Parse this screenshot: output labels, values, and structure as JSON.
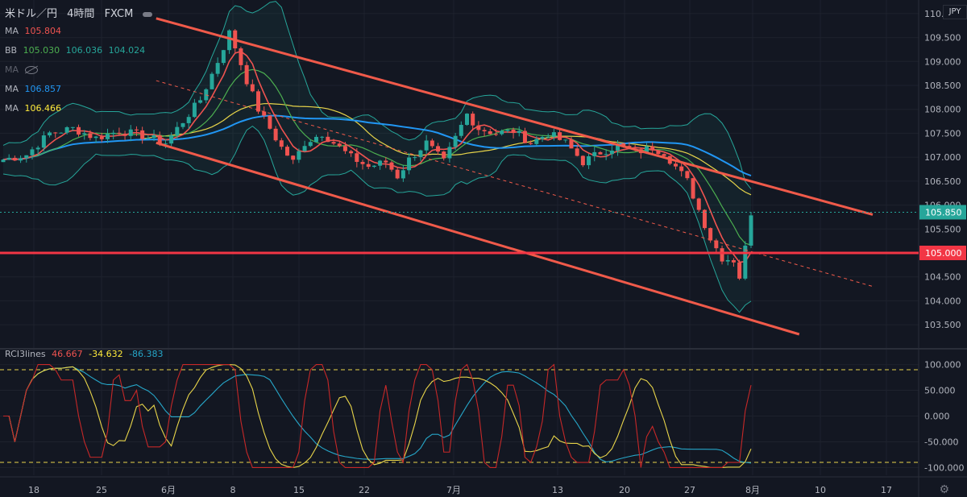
{
  "header": {
    "symbol": "米ドル／円",
    "interval": "4時間",
    "source": "FXCM"
  },
  "legend": [
    {
      "name": "MA",
      "values": [
        {
          "text": "105.804",
          "color": "#ef5350"
        }
      ]
    },
    {
      "name": "BB",
      "values": [
        {
          "text": "105.030",
          "color": "#4caf50"
        },
        {
          "text": "106.036",
          "color": "#26a69a"
        },
        {
          "text": "104.024",
          "color": "#26a69a"
        }
      ]
    },
    {
      "name": "MA",
      "values": [],
      "hidden": true
    },
    {
      "name": "MA",
      "values": [
        {
          "text": "106.857",
          "color": "#2196f3"
        }
      ]
    },
    {
      "name": "MA",
      "values": [
        {
          "text": "106.466",
          "color": "#ffeb3b"
        }
      ]
    }
  ],
  "rci": {
    "name": "RCI3lines",
    "values": [
      {
        "text": "46.667",
        "color": "#ef5350"
      },
      {
        "text": "-34.632",
        "color": "#ffeb3b"
      },
      {
        "text": "-86.383",
        "color": "#26a6c8"
      }
    ]
  },
  "currency": "JPY",
  "price_labels": {
    "current": "105.850",
    "current_color": "#26a69a",
    "level": "105.000",
    "level_color": "#f23645"
  },
  "chart_data": {
    "type": "candlestick",
    "y_ticks": [
      "110.000",
      "109.500",
      "109.000",
      "108.500",
      "108.000",
      "107.500",
      "107.000",
      "106.500",
      "106.000",
      "105.500",
      "105.000",
      "104.500",
      "104.000",
      "103.500"
    ],
    "ylim": [
      103.3,
      110.2
    ],
    "x_ticks": [
      "18",
      "25",
      "6月",
      "8",
      "15",
      "22",
      "7月",
      "13",
      "20",
      "27",
      "8月",
      "10",
      "17"
    ],
    "series_approx": {
      "close_path": [
        [
          0,
          106.95
        ],
        [
          4,
          107.05
        ],
        [
          8,
          107.5
        ],
        [
          12,
          107.6
        ],
        [
          16,
          107.4
        ],
        [
          20,
          107.55
        ],
        [
          24,
          107.45
        ],
        [
          28,
          107.3
        ],
        [
          30,
          107.6
        ],
        [
          34,
          108.2
        ],
        [
          37,
          109.0
        ],
        [
          39,
          109.6
        ],
        [
          40,
          109.3
        ],
        [
          42,
          108.6
        ],
        [
          44,
          108.0
        ],
        [
          46,
          107.6
        ],
        [
          48,
          107.2
        ],
        [
          50,
          106.9
        ],
        [
          52,
          107.3
        ],
        [
          55,
          107.5
        ],
        [
          58,
          107.2
        ],
        [
          60,
          107.0
        ],
        [
          63,
          106.8
        ],
        [
          66,
          106.9
        ],
        [
          68,
          106.6
        ],
        [
          70,
          106.95
        ],
        [
          73,
          107.3
        ],
        [
          76,
          106.9
        ],
        [
          78,
          107.4
        ],
        [
          80,
          107.9
        ],
        [
          82,
          107.6
        ],
        [
          85,
          107.5
        ],
        [
          88,
          107.55
        ],
        [
          91,
          107.3
        ],
        [
          94,
          107.5
        ],
        [
          97,
          107.3
        ],
        [
          100,
          106.9
        ],
        [
          103,
          107.1
        ],
        [
          106,
          107.25
        ],
        [
          109,
          107.1
        ],
        [
          112,
          107.2
        ],
        [
          114,
          107.1
        ],
        [
          116,
          106.8
        ],
        [
          118,
          106.5
        ],
        [
          120,
          105.9
        ],
        [
          122,
          105.3
        ],
        [
          124,
          104.9
        ],
        [
          126,
          104.85
        ],
        [
          127,
          104.5
        ],
        [
          128,
          105.1
        ],
        [
          129,
          105.85
        ]
      ]
    },
    "bollinger_last": {
      "upper": 106.036,
      "mid": 105.03,
      "lower": 104.024
    },
    "ma_last": {
      "red": 105.804,
      "blue": 106.857,
      "yellow": 106.466
    },
    "horizontal_levels": [
      105.0,
      105.85
    ],
    "trendlines": [
      {
        "name": "channel-upper",
        "from": [
          109.9,
          0.17
        ],
        "to": [
          105.8,
          0.95
        ]
      },
      {
        "name": "channel-lower",
        "from": [
          107.3,
          0.17
        ],
        "to": [
          103.3,
          0.87
        ]
      },
      {
        "name": "channel-mid",
        "from": [
          108.6,
          0.17
        ],
        "to": [
          104.3,
          0.95
        ]
      }
    ],
    "rci_panel": {
      "y_ticks": [
        "100.000",
        "50.000",
        "0.000",
        "-50.000",
        "-100.000"
      ],
      "ylim": [
        -115,
        115
      ],
      "bands": [
        90,
        -90
      ],
      "last": {
        "short": 46.667,
        "mid": -34.632,
        "long": -86.383
      }
    }
  }
}
